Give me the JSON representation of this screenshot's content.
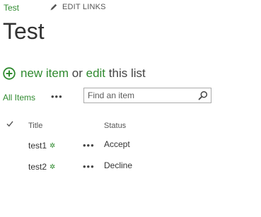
{
  "breadcrumb": {
    "site_link": "Test"
  },
  "edit_links": {
    "label": "EDIT LINKS",
    "icon": "pencil-icon"
  },
  "page": {
    "title": "Test"
  },
  "new_item": {
    "new_item_link": "new item",
    "or_text": "or",
    "edit_link": "edit",
    "rest_text": "this list",
    "icon": "plus-circle-icon"
  },
  "views": {
    "current_view": "All Items",
    "more_label": "•••"
  },
  "search": {
    "placeholder": "Find an item",
    "value": "",
    "icon": "search-icon"
  },
  "list": {
    "columns": {
      "check_icon": "checkmark-icon",
      "title": "Title",
      "status": "Status"
    },
    "rows": [
      {
        "title": "test1",
        "new_badge": "✲",
        "menu": "•••",
        "status": "Accept"
      },
      {
        "title": "test2",
        "new_badge": "✲",
        "menu": "•••",
        "status": "Decline"
      }
    ]
  },
  "colors": {
    "accent": "#2f8a2f",
    "text": "#444444"
  }
}
